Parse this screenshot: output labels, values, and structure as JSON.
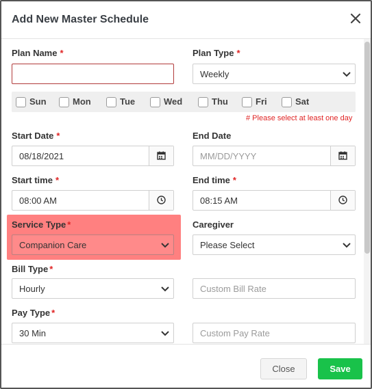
{
  "modal": {
    "title": "Add New Master Schedule",
    "close_icon": "close-icon"
  },
  "form": {
    "plan_name": {
      "label": "Plan Name",
      "required": "*",
      "value": ""
    },
    "plan_type": {
      "label": "Plan Type",
      "required": "*",
      "value": "Weekly"
    },
    "days": [
      {
        "label": "Sun",
        "checked": false
      },
      {
        "label": "Mon",
        "checked": false
      },
      {
        "label": "Tue",
        "checked": false
      },
      {
        "label": "Wed",
        "checked": false
      },
      {
        "label": "Thu",
        "checked": false
      },
      {
        "label": "Fri",
        "checked": false
      },
      {
        "label": "Sat",
        "checked": false
      }
    ],
    "days_error": "# Please select at least one day",
    "start_date": {
      "label": "Start Date",
      "required": "*",
      "value": "08/18/2021",
      "icon": "calendar-icon"
    },
    "end_date": {
      "label": "End Date",
      "placeholder": "MM/DD/YYYY",
      "icon": "calendar-icon"
    },
    "start_time": {
      "label": "Start time",
      "required": "*",
      "value": "08:00 AM",
      "icon": "clock-icon"
    },
    "end_time": {
      "label": "End time",
      "required": "*",
      "value": "08:15 AM",
      "icon": "clock-icon"
    },
    "service_type": {
      "label": "Service Type",
      "required": "*",
      "value": "Companion Care",
      "highlight_color": "#ff8080"
    },
    "caregiver": {
      "label": "Caregiver",
      "value": "Please Select"
    },
    "bill_type": {
      "label": "Bill Type",
      "required": "*",
      "value": "Hourly"
    },
    "custom_bill_rate": {
      "placeholder": "Custom Bill Rate"
    },
    "pay_type": {
      "label": "Pay Type",
      "required": "*",
      "value": "30 Min"
    },
    "custom_pay_rate": {
      "placeholder": "Custom Pay Rate"
    }
  },
  "footer": {
    "close_label": "Close",
    "save_label": "Save",
    "save_color": "#19c24a"
  }
}
